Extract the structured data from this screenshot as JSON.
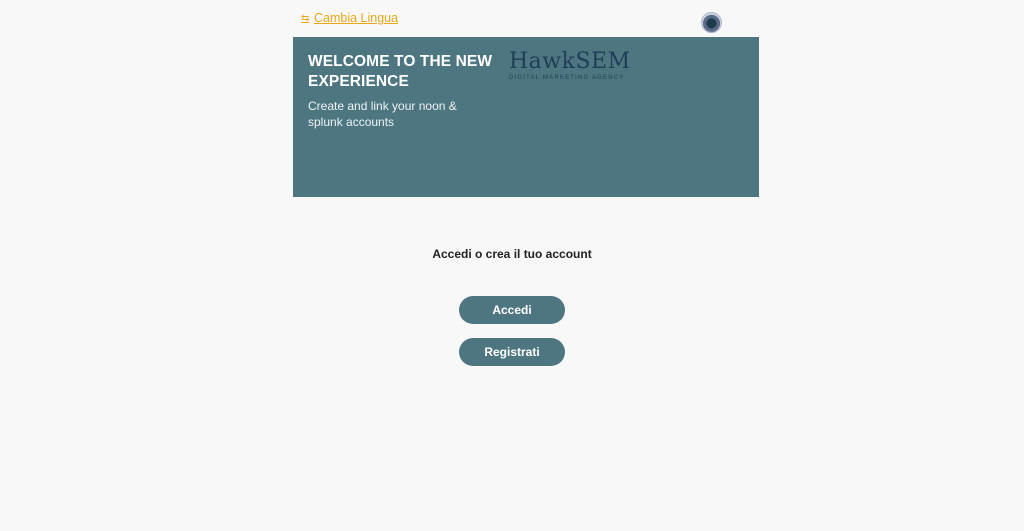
{
  "header": {
    "language_link": "Cambia Lingua",
    "language_icon": "translate-icon",
    "avatar_icon": "user-avatar-icon"
  },
  "banner": {
    "title": "WELCOME TO THE NEW EXPERIENCE",
    "subtitle": "Create and link your noon & splunk accounts",
    "logo_name": "HawkSEM",
    "logo_tagline": "DIGITAL MARKETING AGENCY",
    "background_color": "#4e7681"
  },
  "main": {
    "prompt": "Accedi o crea il tuo account",
    "login_button": "Accedi",
    "register_button": "Registrati"
  },
  "colors": {
    "accent": "#4e7681",
    "link": "#e6a817",
    "background": "#f8f8f8"
  }
}
